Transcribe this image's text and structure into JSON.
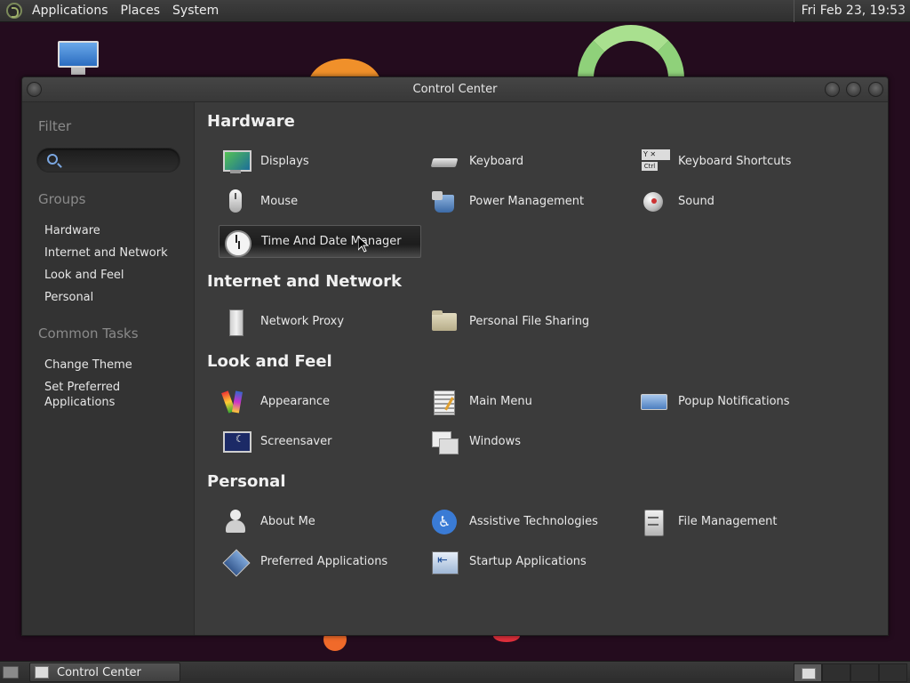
{
  "top_panel": {
    "menus": [
      "Applications",
      "Places",
      "System"
    ],
    "clock": "Fri Feb 23, 19:53"
  },
  "window": {
    "title": "Control Center"
  },
  "sidebar": {
    "filter_heading": "Filter",
    "search_placeholder": "",
    "groups_heading": "Groups",
    "groups": [
      "Hardware",
      "Internet and Network",
      "Look and Feel",
      "Personal"
    ],
    "tasks_heading": "Common Tasks",
    "tasks": [
      "Change Theme",
      "Set Preferred Applications"
    ]
  },
  "sections": {
    "hardware": {
      "title": "Hardware",
      "items": [
        {
          "label": "Displays",
          "icon": "displays-icon"
        },
        {
          "label": "Keyboard",
          "icon": "keyboard-icon"
        },
        {
          "label": "Keyboard Shortcuts",
          "icon": "keyboard-shortcuts-icon"
        },
        {
          "label": "Mouse",
          "icon": "mouse-icon"
        },
        {
          "label": "Power Management",
          "icon": "power-management-icon"
        },
        {
          "label": "Sound",
          "icon": "sound-icon"
        },
        {
          "label": "Time And Date Manager",
          "icon": "clock-icon",
          "selected": true
        }
      ]
    },
    "internet": {
      "title": "Internet and Network",
      "items": [
        {
          "label": "Network Proxy",
          "icon": "network-proxy-icon"
        },
        {
          "label": "Personal File Sharing",
          "icon": "file-sharing-icon"
        }
      ]
    },
    "look": {
      "title": "Look and Feel",
      "items": [
        {
          "label": "Appearance",
          "icon": "appearance-icon"
        },
        {
          "label": "Main Menu",
          "icon": "main-menu-icon"
        },
        {
          "label": "Popup Notifications",
          "icon": "popup-notifications-icon"
        },
        {
          "label": "Screensaver",
          "icon": "screensaver-icon"
        },
        {
          "label": "Windows",
          "icon": "windows-icon"
        }
      ]
    },
    "personal": {
      "title": "Personal",
      "items": [
        {
          "label": "About Me",
          "icon": "about-me-icon"
        },
        {
          "label": "Assistive Technologies",
          "icon": "assistive-technologies-icon"
        },
        {
          "label": "File Management",
          "icon": "file-management-icon"
        },
        {
          "label": "Preferred Applications",
          "icon": "preferred-applications-icon"
        },
        {
          "label": "Startup Applications",
          "icon": "startup-applications-icon"
        }
      ]
    }
  },
  "bottom_panel": {
    "taskbar_label": "Control Center"
  },
  "colors": {
    "window_bg": "#3b3b3b",
    "sidebar_bg": "#333333",
    "desktop_bg": "#240c1e",
    "panel_bg": "#333333"
  }
}
